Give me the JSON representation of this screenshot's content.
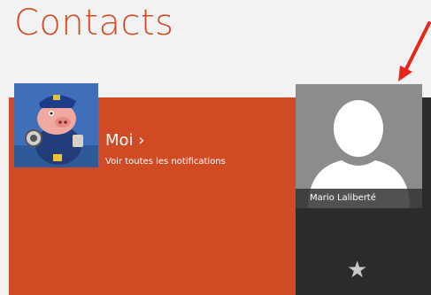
{
  "header": {
    "title": "Contacts"
  },
  "me_tile": {
    "name": "Moi ›",
    "subtitle": "Voir toutes les notifications",
    "photo_icon": "pig-character-icon"
  },
  "contact_tile": {
    "name": "Mario Laliberté",
    "avatar_icon": "person-silhouette-icon",
    "favorite_icon": "star-icon",
    "favorite_glyph": "★"
  },
  "annotation": {
    "icon": "red-arrow-icon",
    "color": "#e8261b"
  },
  "colors": {
    "accent": "#d04a23",
    "tile_dark": "#2b2b2b",
    "avatar_bg": "#8c8c8c"
  }
}
